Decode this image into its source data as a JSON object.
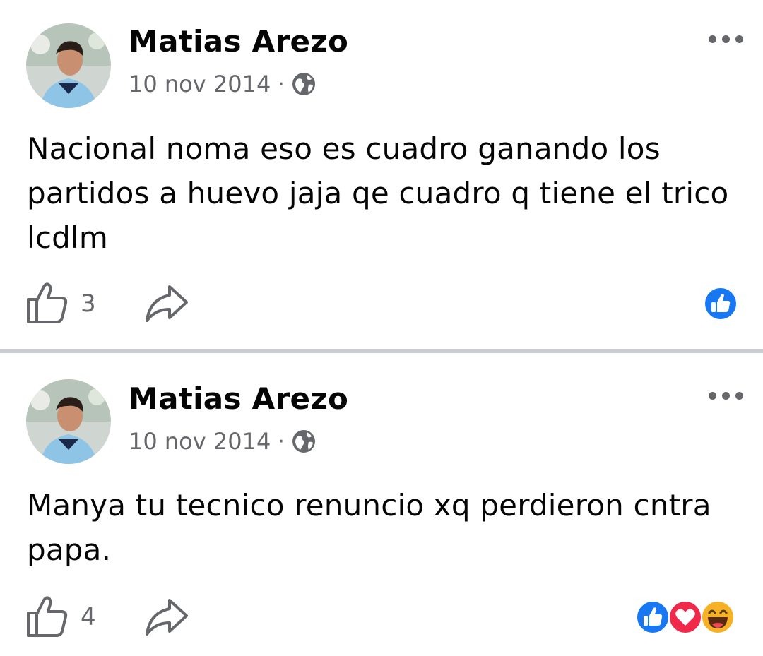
{
  "posts": [
    {
      "author": "Matias Arezo",
      "date": "10 nov 2014",
      "separator": "·",
      "privacy_icon": "globe-icon",
      "text": "Nacional noma eso es cuadro ganando los partidos a huevo jaja qe cuadro q tiene el trico lcdlm",
      "like_count": "3",
      "reactions": [
        "like"
      ]
    },
    {
      "author": "Matias Arezo",
      "date": "10 nov 2014",
      "separator": "·",
      "privacy_icon": "globe-icon",
      "text": "Manya tu tecnico renuncio xq perdieron cntra papa.",
      "like_count": "4",
      "reactions": [
        "like",
        "love",
        "haha"
      ]
    }
  ],
  "colors": {
    "like_blue": "#1877f2",
    "love_red": "#f0284a",
    "haha_yellow": "#f7b125",
    "secondary_text": "#65676b",
    "divider": "#c9ccd1"
  }
}
